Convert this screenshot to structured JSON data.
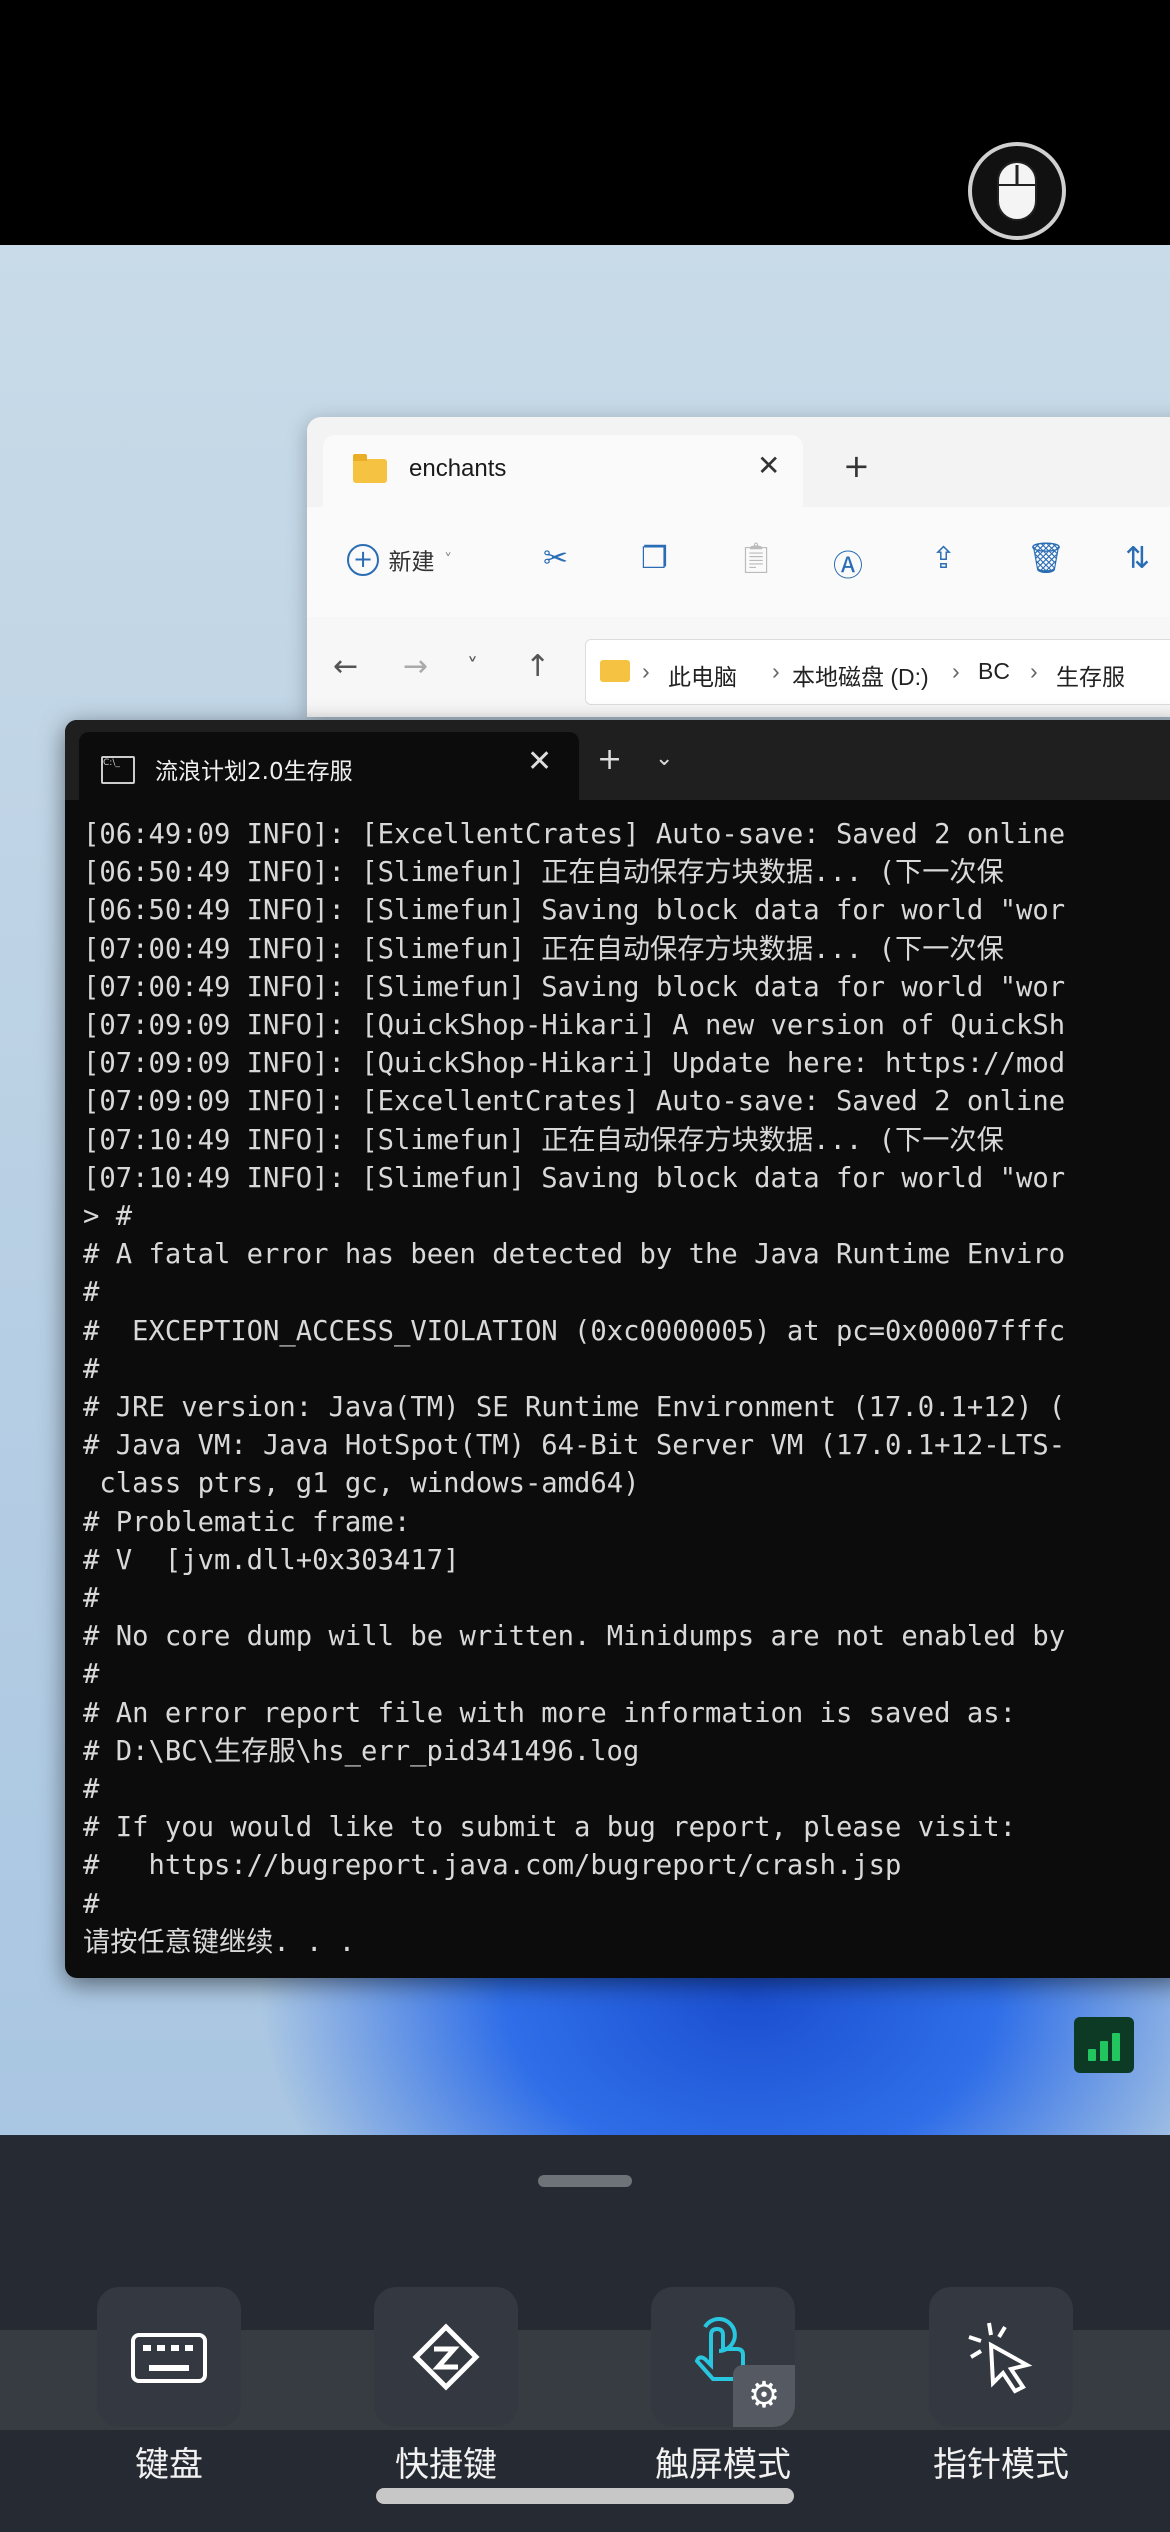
{
  "explorer": {
    "tab_title": "enchants",
    "new_label": "新建",
    "breadcrumb": [
      "此电脑",
      "本地磁盘 (D:)",
      "BC",
      "生存服"
    ]
  },
  "terminal": {
    "tab_title": "流浪计划2.0生存服",
    "lines": [
      "[06:49:09 INFO]: [ExcellentCrates] Auto-save: Saved 2 online",
      "[06:50:49 INFO]: [Slimefun] 正在自动保存方块数据... (下一次保",
      "[06:50:49 INFO]: [Slimefun] Saving block data for world \"wor",
      "[07:00:49 INFO]: [Slimefun] 正在自动保存方块数据... (下一次保",
      "[07:00:49 INFO]: [Slimefun] Saving block data for world \"wor",
      "[07:09:09 INFO]: [QuickShop-Hikari] A new version of QuickSh",
      "[07:09:09 INFO]: [QuickShop-Hikari] Update here: https://mod",
      "[07:09:09 INFO]: [ExcellentCrates] Auto-save: Saved 2 online",
      "[07:10:49 INFO]: [Slimefun] 正在自动保存方块数据... (下一次保",
      "[07:10:49 INFO]: [Slimefun] Saving block data for world \"wor",
      "> #",
      "# A fatal error has been detected by the Java Runtime Enviro",
      "#",
      "#  EXCEPTION_ACCESS_VIOLATION (0xc0000005) at pc=0x00007fffc",
      "#",
      "# JRE version: Java(TM) SE Runtime Environment (17.0.1+12) (",
      "# Java VM: Java HotSpot(TM) 64-Bit Server VM (17.0.1+12-LTS-",
      " class ptrs, g1 gc, windows-amd64)",
      "# Problematic frame:",
      "# V  [jvm.dll+0x303417]",
      "#",
      "# No core dump will be written. Minidumps are not enabled by",
      "#",
      "# An error report file with more information is saved as:",
      "# D:\\BC\\生存服\\hs_err_pid341496.log",
      "#",
      "# If you would like to submit a bug report, please visit:",
      "#   https://bugreport.java.com/bugreport/crash.jsp",
      "#",
      "请按任意键继续. . ."
    ]
  },
  "toolbar": {
    "keyboard_label": "键盘",
    "shortcut_label": "快捷键",
    "touch_mode_label": "触屏模式",
    "pointer_mode_label": "指针模式"
  },
  "colors": {
    "accent": "#29c6e0",
    "panel": "#282c34",
    "signal": "#22c65e"
  }
}
